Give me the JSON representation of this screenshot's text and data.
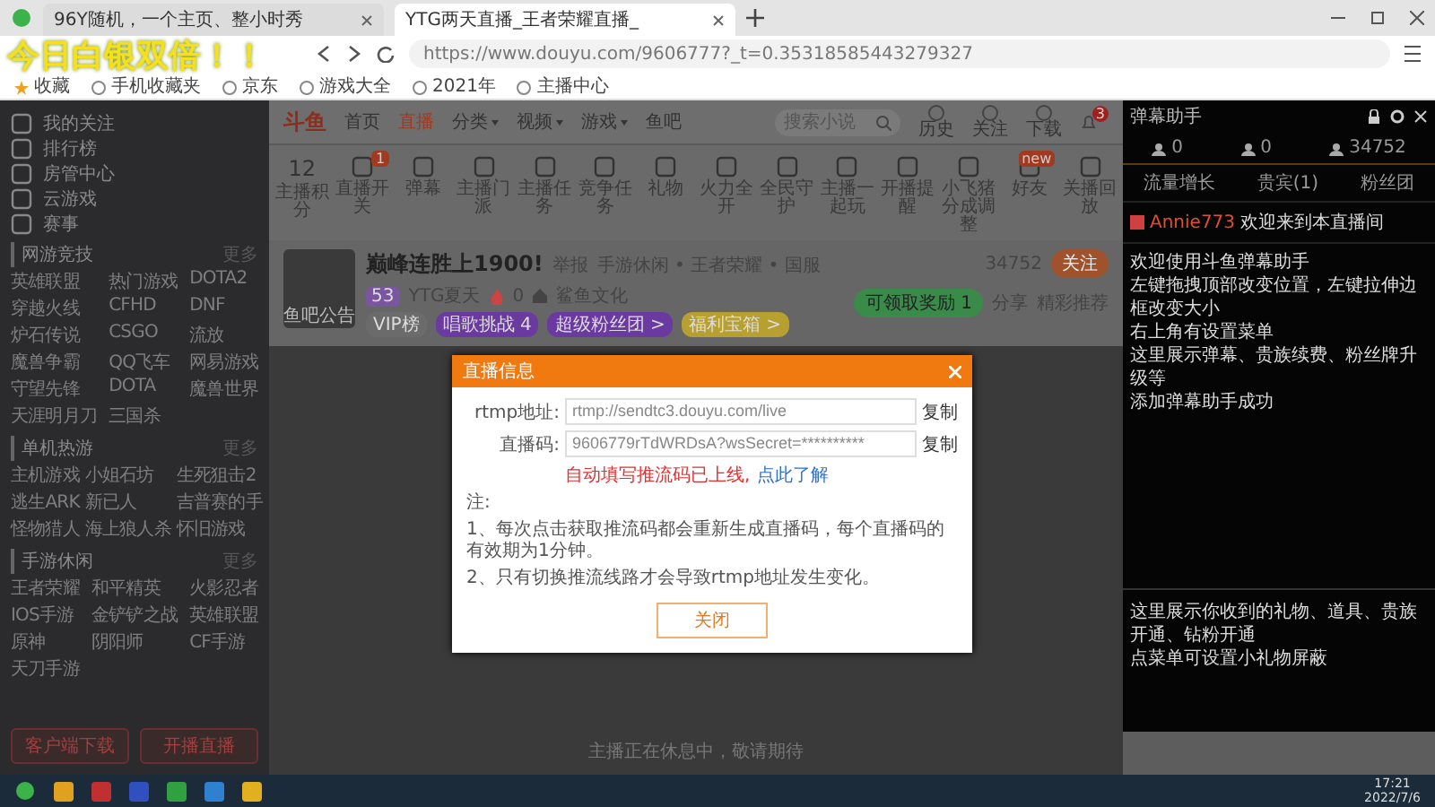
{
  "browser": {
    "tabs": [
      {
        "title": "96Y随机，一个主页、整小时秀",
        "selected": false
      },
      {
        "title": "YTG两天直播_王者荣耀直播_",
        "selected": true
      }
    ],
    "url": "https://www.douyu.com/9606777?_t=0.35318585443279327",
    "bookmarks": [
      "收藏",
      "手机收藏夹",
      "京东",
      "游戏大全",
      "2021年",
      "主播中心"
    ]
  },
  "overlay_caption": "今日白银双倍！！",
  "nav": {
    "logo": "斗鱼",
    "items": [
      {
        "label": "首页",
        "selected": false,
        "menu": false
      },
      {
        "label": "直播",
        "selected": true,
        "menu": false
      },
      {
        "label": "分类",
        "selected": false,
        "menu": true
      },
      {
        "label": "视频",
        "selected": false,
        "menu": true
      },
      {
        "label": "游戏",
        "selected": false,
        "menu": true
      },
      {
        "label": "鱼吧",
        "selected": false,
        "menu": false
      }
    ],
    "search": {
      "placeholder": "搜索小说"
    },
    "shortcuts": [
      "历史",
      "关注",
      "下载"
    ],
    "notice_badge": "3"
  },
  "toolbar": {
    "score": "12",
    "score_label": "主播积分",
    "items": [
      {
        "label": "直播开关",
        "badge": "1"
      },
      {
        "label": "弹幕"
      },
      {
        "label": "主播门派"
      },
      {
        "label": "主播任务"
      },
      {
        "label": "竞争任务"
      },
      {
        "label": "礼物"
      },
      {
        "label": "火力全开"
      },
      {
        "label": "全民守护"
      },
      {
        "label": "主播一起玩"
      },
      {
        "label": "开播提醒"
      },
      {
        "label": "小飞猪分成调整"
      },
      {
        "label": "好友",
        "badge": "new"
      },
      {
        "label": "关播回放"
      }
    ]
  },
  "room": {
    "title": "巅峰连胜上1900!",
    "report": "举报",
    "category": "手游休闲 • 王者荣耀 • 国服",
    "level": "53",
    "anchor": "YTG夏天",
    "hot": "0",
    "guild": "鲨鱼文化",
    "avatar_caption": [
      "鱼吧",
      "公告"
    ],
    "followers": "34752",
    "follow_button": "关注",
    "badges": [
      {
        "label": "VIP榜",
        "color": "#6b6b6b"
      },
      {
        "label": "唱歌挑战 4",
        "color": "#6a3aa0"
      },
      {
        "label": "超级粉丝团 >",
        "color": "#6a3aa0"
      },
      {
        "label": "福利宝箱 >",
        "color": "#b8a030"
      }
    ],
    "reward": "可领取奖励 1",
    "share": "分享",
    "recommend": "精彩推荐"
  },
  "sidebar": {
    "items": [
      "我的关注",
      "排行榜",
      "房管中心",
      "云游戏",
      "赛事"
    ],
    "sections": [
      {
        "title": "网游竞技",
        "more": "更多",
        "games": [
          "英雄联盟",
          "热门游戏",
          "DOTA2",
          "穿越火线",
          "CFHD",
          "DNF",
          "炉石传说",
          "CSGO",
          "流放",
          "魔兽争霸",
          "QQ飞车",
          "网易游戏",
          "守望先锋",
          "DOTA",
          "魔兽世界",
          "天涯明月刀",
          "三国杀"
        ]
      },
      {
        "title": "单机热游",
        "more": "更多",
        "games": [
          "主机游戏",
          "小姐石坊",
          "生死狙击2",
          "逃生ARK",
          "新已人",
          "吉普赛的手",
          "怪物猎人",
          "海上狼人杀",
          "怀旧游戏"
        ]
      },
      {
        "title": "手游休闲",
        "more": "更多",
        "games": [
          "王者荣耀",
          "和平精英",
          "火影忍者",
          "IOS手游",
          "金铲铲之战",
          "英雄联盟",
          "原神",
          "阴阳师",
          "CF手游",
          "天刀手游"
        ]
      }
    ],
    "buttons": [
      "客户端下载",
      "开播直播"
    ]
  },
  "player_message": "主播正在休息中，敬请期待",
  "dialog": {
    "title": "直播信息",
    "fields": [
      {
        "label": "rtmp地址:",
        "value": "rtmp://sendtc3.douyu.com/live",
        "action": "复制"
      },
      {
        "label": "直播码:",
        "value": "9606779rTdWRDsA?wsSecret=**********",
        "action": "复制"
      }
    ],
    "warning": "自动填写推流码已上线,",
    "link": "点此了解",
    "notes_title": "注:",
    "notes": [
      "1、每次点击获取推流码都会重新生成直播码，每个直播码的有效期为1分钟。",
      "2、只有切换推流线路才会导致rtmp地址发生变化。"
    ],
    "close_button": "关闭"
  },
  "assistant": {
    "title": "弹幕助手",
    "stats": [
      "0",
      "0",
      "34752"
    ],
    "tabs": [
      "流量增长",
      "贵宾(1)",
      "粉丝团"
    ],
    "welcome_user": "Annie773",
    "welcome_text": "欢迎来到本直播间",
    "messages": [
      "欢迎使用斗鱼弹幕助手",
      "左键拖拽顶部改变位置，左键拉伸边框改变大小",
      "右上角有设置菜单",
      "这里展示弹幕、贵族续费、粉丝牌升级等",
      "添加弹幕助手成功"
    ],
    "gift_notes": [
      "这里展示你收到的礼物、道具、贵族开通、钻粉开通",
      "点菜单可设置小礼物屏蔽"
    ]
  },
  "taskbar": {
    "time": "17:21",
    "date": "2022/7/6"
  }
}
